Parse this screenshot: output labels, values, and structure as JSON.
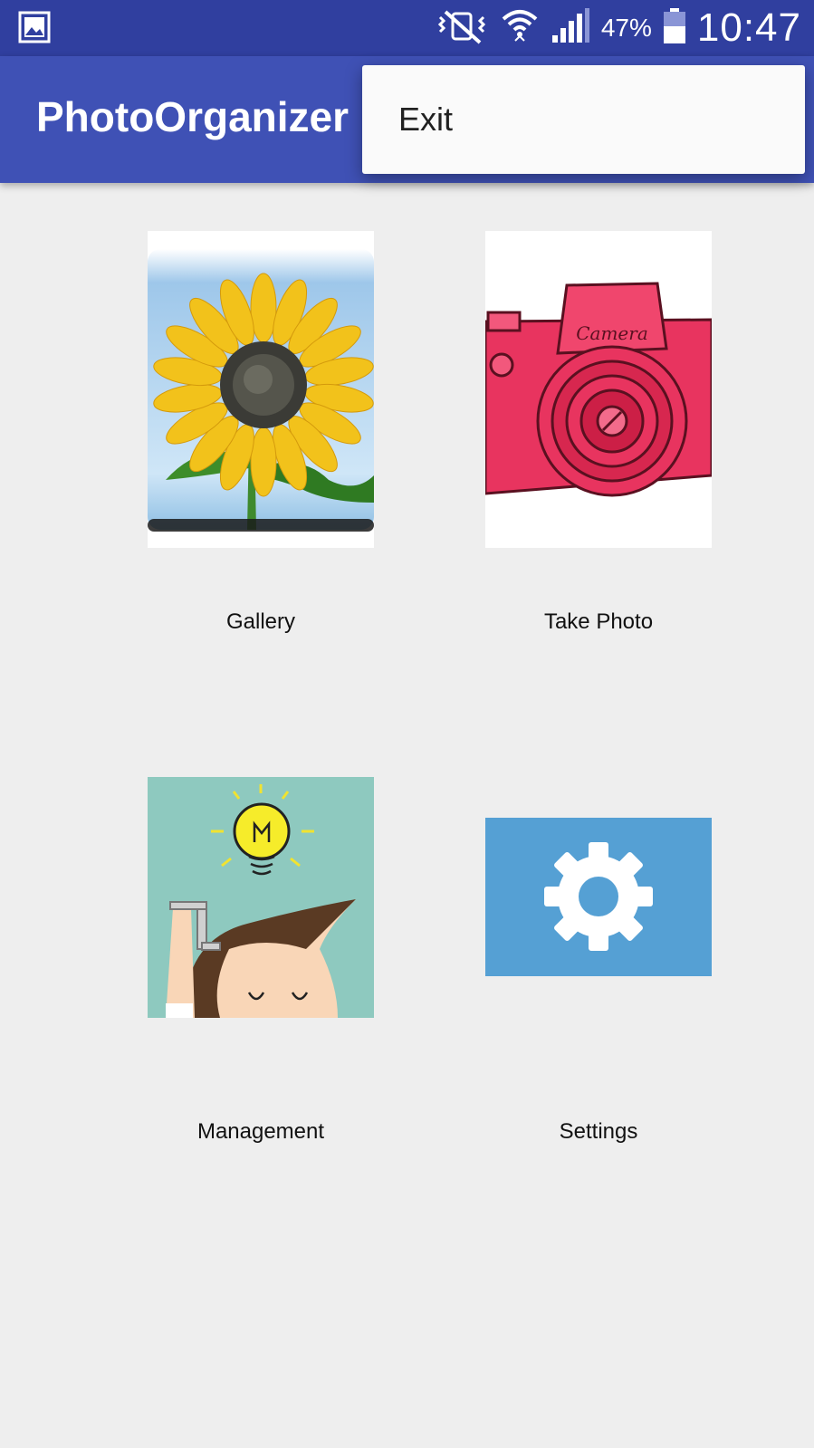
{
  "status_bar": {
    "left_icon": "image-icon",
    "right_icons": [
      "mute-vibrate-icon",
      "wifi-icon",
      "signal-icon",
      "battery-icon"
    ],
    "battery_percent": "47%",
    "time": "10:47"
  },
  "app_bar": {
    "title": "PhotoOrganizer",
    "background": "#3f51b5",
    "status_bar_background": "#303f9f"
  },
  "overflow_menu": {
    "items": [
      {
        "label": "Exit"
      }
    ]
  },
  "tiles": [
    {
      "label": "Gallery",
      "icon": "sunflower-image"
    },
    {
      "label": "Take Photo",
      "icon": "camera-image"
    },
    {
      "label": "Management",
      "icon": "lightbulb-person-image"
    },
    {
      "label": "Settings",
      "icon": "gear-icon"
    }
  ],
  "colors": {
    "page_background": "#eeeeee",
    "settings_tile": "#55a0d4",
    "camera_pink": "#e8345f"
  }
}
